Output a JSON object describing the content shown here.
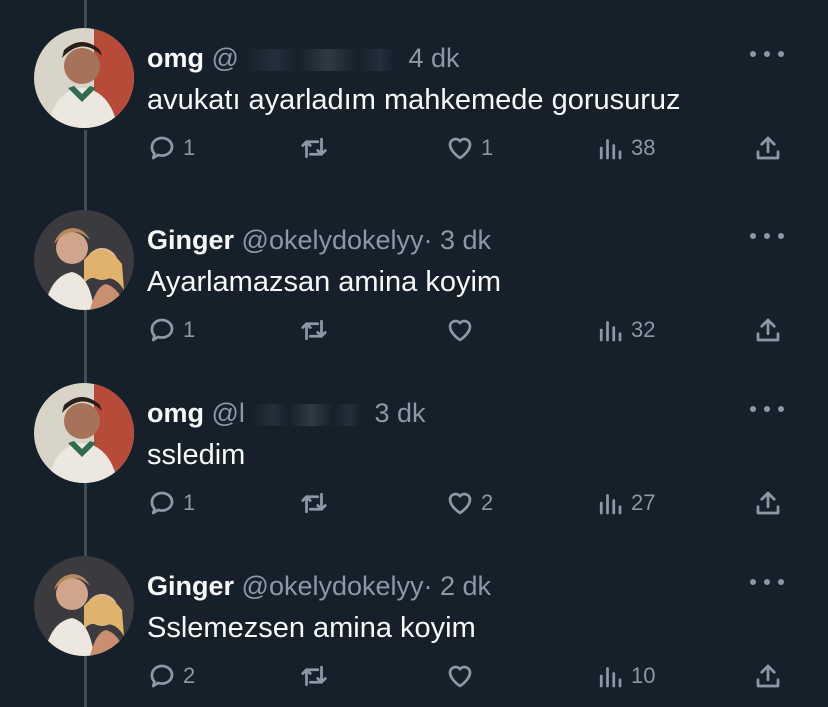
{
  "colors": {
    "background": "#15202b",
    "text": "#f7f9f9",
    "muted": "#8b98a5",
    "thread_line": "#3f4d5a"
  },
  "tweets": [
    {
      "name": "omg",
      "handle": "@",
      "handle_redacted": true,
      "time": "4 dk",
      "text": "avukatı ayarladım mahkemede gorusuruz",
      "replies": "1",
      "retweets": "",
      "likes": "1",
      "views": "38",
      "avatar": "avatar-omg"
    },
    {
      "name": "Ginger",
      "handle": "@okelydokelyy",
      "handle_redacted": false,
      "time": "· 3 dk",
      "text": "Ayarlamazsan amina koyim",
      "replies": "1",
      "retweets": "",
      "likes": "",
      "views": "32",
      "avatar": "avatar-ginger"
    },
    {
      "name": "omg",
      "handle": "@l",
      "handle_redacted": true,
      "time": "3 dk",
      "text": "ssledim",
      "replies": "1",
      "retweets": "",
      "likes": "2",
      "views": "27",
      "avatar": "avatar-omg"
    },
    {
      "name": "Ginger",
      "handle": "@okelydokelyy",
      "handle_redacted": false,
      "time": "· 2 dk",
      "text": "Sslemezsen amina koyim",
      "replies": "2",
      "retweets": "",
      "likes": "",
      "views": "10",
      "avatar": "avatar-ginger"
    }
  ],
  "icons": {
    "reply": "reply-icon",
    "retweet": "retweet-icon",
    "like": "heart-icon",
    "views": "views-chart-icon",
    "share": "share-icon",
    "more": "more-dots-icon"
  }
}
